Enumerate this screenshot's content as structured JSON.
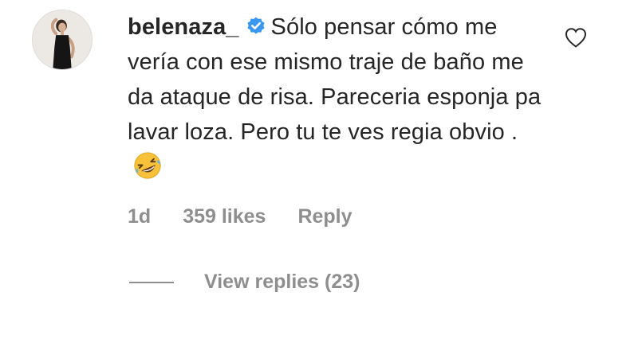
{
  "comment": {
    "username": "belenaza_",
    "verified_icon": "verified-badge-icon",
    "text": "Sólo pensar cómo me vería con ese mismo traje de baño me da ataque de risa. Pareceria esponja pa lavar loza. Pero tu te ves regia obvio .",
    "emoji_icon": "rofl-emoji-icon",
    "age": "1d",
    "likes": "359 likes",
    "reply_label": "Reply",
    "view_replies_label": "View replies (23)",
    "like_icon": "heart-outline-icon"
  },
  "colors": {
    "text_primary": "#262626",
    "text_secondary": "#8e8e8e",
    "verified_blue": "#3897f0"
  }
}
